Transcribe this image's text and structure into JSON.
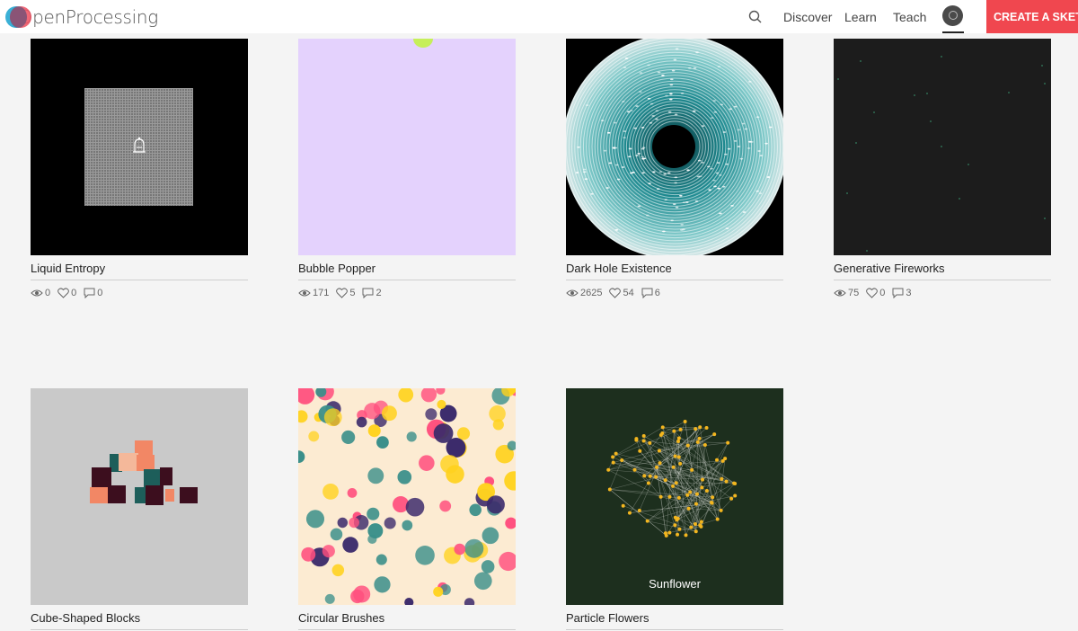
{
  "brand": {
    "name": "OpenProcessing"
  },
  "nav": {
    "items": [
      {
        "label": "Discover"
      },
      {
        "label": "Learn"
      },
      {
        "label": "Teach"
      }
    ],
    "create_button": "CREATE A SKETCH"
  },
  "colors": {
    "accent": "#f0474f",
    "page_bg": "#f4f4f4"
  },
  "sketches": [
    {
      "title": "Liquid Entropy",
      "views": "0",
      "likes": "0",
      "comments": "0"
    },
    {
      "title": "Bubble Popper",
      "views": "171",
      "likes": "5",
      "comments": "2"
    },
    {
      "title": "Dark Hole Existence",
      "views": "2625",
      "likes": "54",
      "comments": "6"
    },
    {
      "title": "Generative Fireworks",
      "views": "75",
      "likes": "0",
      "comments": "3"
    },
    {
      "title": "Cube-Shaped Blocks"
    },
    {
      "title": "Circular Brushes"
    },
    {
      "title": "Particle Flowers",
      "thumbnail_text": "Sunflower"
    }
  ]
}
